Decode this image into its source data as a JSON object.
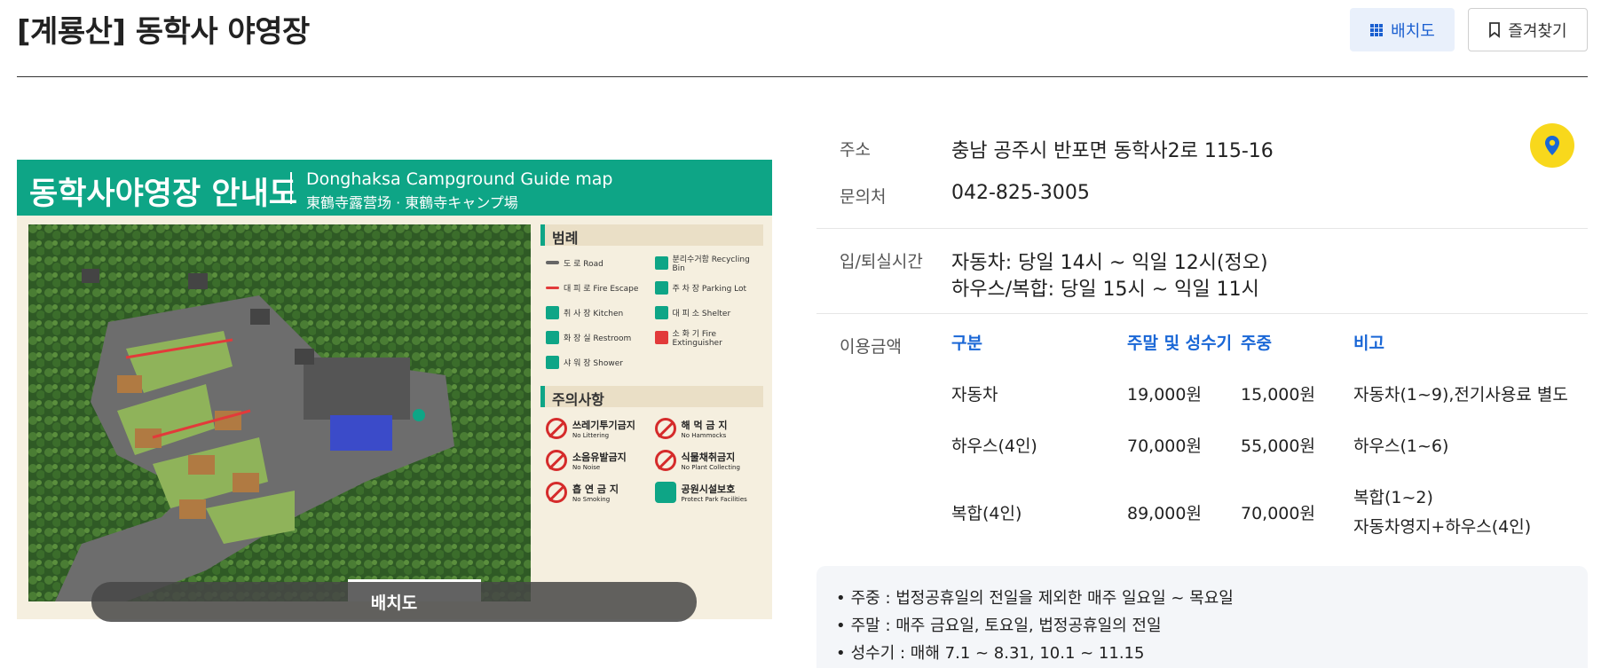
{
  "page": {
    "title": "[계룡산] 동학사 야영장",
    "map_button": "배치도",
    "favorite_button": "즐겨찾기"
  },
  "map": {
    "header_ko": "동학사야영장 안내도",
    "header_en": "Donghaksa Campground Guide map",
    "header_cjk": "東鶴寺露营场 · 東鶴寺キャンプ場",
    "legend_title": "범례",
    "legend_items": [
      {
        "label": "도 로  Road",
        "icon": "road-icon"
      },
      {
        "label": "분리수거함  Recycling Bin",
        "icon": "recycle-icon"
      },
      {
        "label": "대 피 로  Fire Escape",
        "icon": "escape-arrow-icon"
      },
      {
        "label": "주 차 장  Parking Lot",
        "icon": "parking-icon"
      },
      {
        "label": "취 사 장  Kitchen",
        "icon": "kitchen-icon"
      },
      {
        "label": "대 피 소  Shelter",
        "icon": "shelter-icon"
      },
      {
        "label": "화 장 실  Restroom",
        "icon": "restroom-icon"
      },
      {
        "label": "소 화 기  Fire Extinguisher",
        "icon": "extinguisher-icon"
      },
      {
        "label": "샤 워 장  Shower",
        "icon": "shower-icon"
      }
    ],
    "caution_title": "주의사항",
    "caution_items": [
      {
        "label": "쓰레기투기금지",
        "sub": "No Littering",
        "icon": "no-littering-icon"
      },
      {
        "label": "해 먹 금 지",
        "sub": "No Hammocks",
        "icon": "no-hammock-icon"
      },
      {
        "label": "소음유발금지",
        "sub": "No Noise",
        "icon": "no-noise-icon"
      },
      {
        "label": "식물채취금지",
        "sub": "No Plant Collecting",
        "icon": "no-plant-icon"
      },
      {
        "label": "흡 연 금 지",
        "sub": "No Smoking",
        "icon": "no-smoking-icon"
      },
      {
        "label": "공원시설보호",
        "sub": "Protect Park Facilities",
        "icon": "protect-icon"
      }
    ],
    "caption": "배치도"
  },
  "info": {
    "address_label": "주소",
    "address": "충남 공주시 반포면 동학사2로 115-16",
    "contact_label": "문의처",
    "contact": "042-825-3005",
    "checkin_label": "입/퇴실시간",
    "checkin_lines": [
      "자동차: 당일 14시 ~ 익일 12시(정오)",
      "하우스/복합: 당일 15시 ~ 익일 11시"
    ],
    "price_label": "이용금액"
  },
  "price_table": {
    "headers": [
      "구분",
      "주말 및 성수기",
      "주중",
      "비고"
    ],
    "rows": [
      {
        "type": "자동차",
        "weekend": "19,000원",
        "weekday": "15,000원",
        "note": [
          "자동차(1~9),전기사용료 별도"
        ]
      },
      {
        "type": "하우스(4인)",
        "weekend": "70,000원",
        "weekday": "55,000원",
        "note": [
          "하우스(1~6)"
        ]
      },
      {
        "type": "복합(4인)",
        "weekend": "89,000원",
        "weekday": "70,000원",
        "note": [
          "복합(1~2)",
          "자동차영지+하우스(4인)"
        ]
      }
    ]
  },
  "notice": [
    "주중 : 법정공휴일의 전일을 제외한 매주 일요일 ~ 목요일",
    "주말 : 매주 금요일, 토요일, 법정공휴일의 전일",
    "성수기 : 매해 7.1 ~ 8.31, 10.1 ~ 11.15"
  ],
  "colors": {
    "accent": "#1a67d6",
    "map_green": "#0ea586",
    "pin_yellow": "#f8d81c"
  }
}
